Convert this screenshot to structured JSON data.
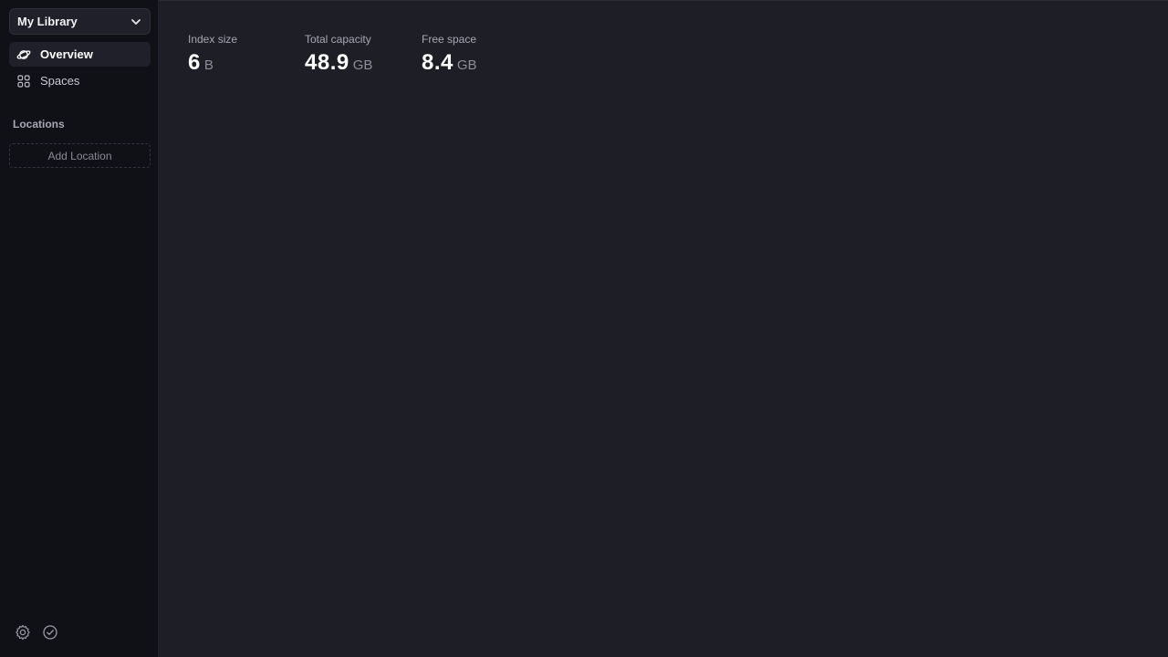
{
  "sidebar": {
    "library_selector": {
      "label": "My Library"
    },
    "nav": [
      {
        "label": "Overview",
        "icon": "planet-icon",
        "active": true
      },
      {
        "label": "Spaces",
        "icon": "grid-icon",
        "active": false
      }
    ],
    "locations": {
      "title": "Locations",
      "add_label": "Add Location"
    },
    "footer_icons": [
      "gear-icon",
      "check-circle-icon"
    ]
  },
  "main": {
    "stats": [
      {
        "title": "Index size",
        "value": "6",
        "unit": "B"
      },
      {
        "title": "Total capacity",
        "value": "48.9",
        "unit": "GB"
      },
      {
        "title": "Free space",
        "value": "8.4",
        "unit": "GB"
      }
    ]
  },
  "colors": {
    "background": "#1e1e27",
    "sidebar": "#101116",
    "active_item": "#1f2029",
    "muted_text": "#a6a7b3"
  }
}
